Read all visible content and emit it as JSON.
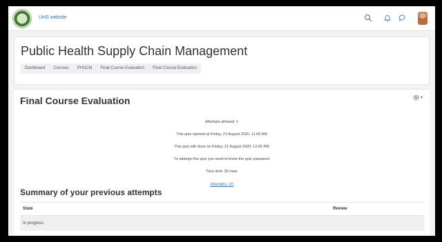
{
  "navbar": {
    "site_link": "UHS website",
    "icons": [
      "search-icon",
      "bell-icon",
      "chat-icon",
      "user-avatar"
    ]
  },
  "header": {
    "title": "Public Health Supply Chain Management",
    "breadcrumb": [
      "Dashboard",
      "Courses",
      "PHSCM",
      "Final Course Evaluation",
      "Final Course Evaluation"
    ]
  },
  "quiz": {
    "title": "Final Course Evaluation",
    "attempts_allowed": "Attempts allowed: 1",
    "opened": "This quiz opened at Friday, 21 August 2020, 11:00 AM",
    "closes": "This quiz will close on Friday, 21 August 2020, 12:00 PM",
    "password_note": "To attempt this quiz you need to know the quiz password",
    "time_limit": "Time limit: 30 mins",
    "attempts_link": "Attempts: 20"
  },
  "summary": {
    "title": "Summary of your previous attempts",
    "columns": [
      "State",
      "Review"
    ],
    "rows": [
      {
        "state": "In progress",
        "review": ""
      }
    ]
  },
  "colors": {
    "link": "#3a6fb5",
    "background": "#f2f3f5"
  }
}
